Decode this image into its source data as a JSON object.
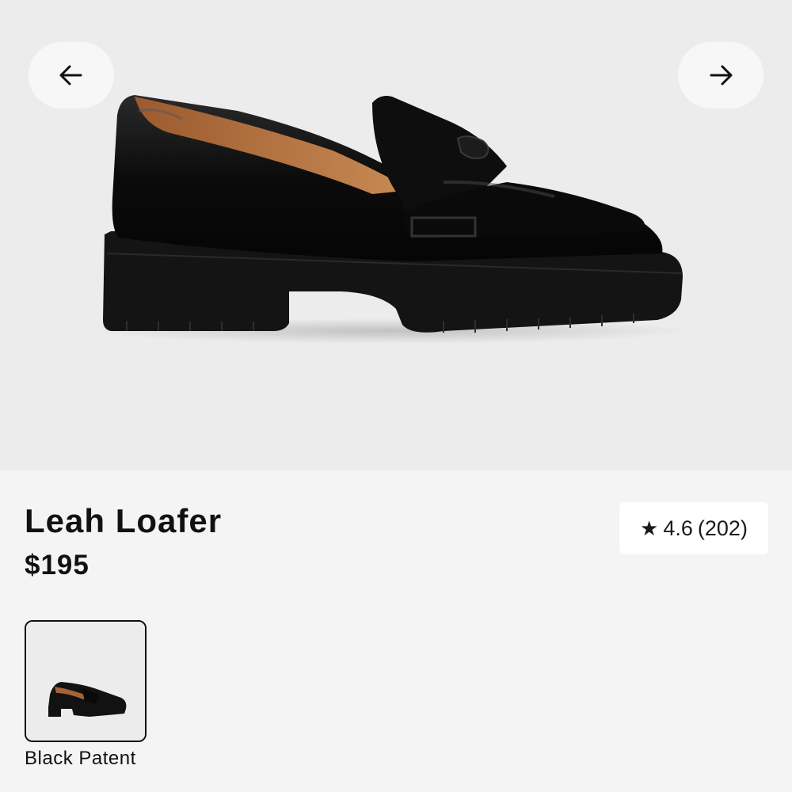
{
  "product": {
    "name": "Leah Loafer",
    "price": "$195",
    "rating": {
      "score": "4.6",
      "count": "(202)"
    },
    "colors": [
      {
        "label": "Black Patent",
        "selected": true
      }
    ]
  },
  "gallery": {
    "prev_icon": "arrow-left-icon",
    "next_icon": "arrow-right-icon"
  },
  "theme": {
    "hero_bg": "#ececec",
    "page_bg": "#f4f4f4",
    "text": "#111111"
  }
}
